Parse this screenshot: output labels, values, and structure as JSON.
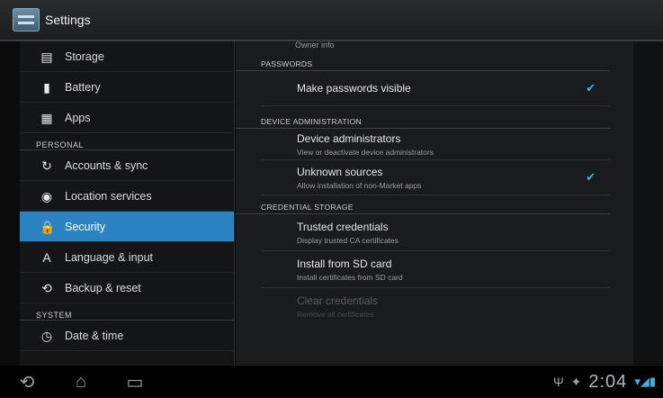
{
  "actionbar": {
    "title": "Settings"
  },
  "left": {
    "items": [
      {
        "type": "item",
        "label": "Storage",
        "icon": "storage-icon",
        "glyph": "▤"
      },
      {
        "type": "item",
        "label": "Battery",
        "icon": "battery-icon",
        "glyph": "▮"
      },
      {
        "type": "item",
        "label": "Apps",
        "icon": "apps-icon",
        "glyph": "▦"
      },
      {
        "type": "header",
        "label": "PERSONAL"
      },
      {
        "type": "item",
        "label": "Accounts & sync",
        "icon": "sync-icon",
        "glyph": "↻"
      },
      {
        "type": "item",
        "label": "Location services",
        "icon": "location-icon",
        "glyph": "◉"
      },
      {
        "type": "item",
        "label": "Security",
        "icon": "lock-icon",
        "glyph": "🔒",
        "active": true
      },
      {
        "type": "item",
        "label": "Language & input",
        "icon": "language-icon",
        "glyph": "A"
      },
      {
        "type": "item",
        "label": "Backup & reset",
        "icon": "backup-icon",
        "glyph": "⟲"
      },
      {
        "type": "header",
        "label": "SYSTEM"
      },
      {
        "type": "item",
        "label": "Date & time",
        "icon": "clock-icon",
        "glyph": "◷"
      }
    ]
  },
  "right": {
    "partial_top": "Owner info",
    "sections": {
      "passwords": "PASSWORDS",
      "device_admin": "DEVICE ADMINISTRATION",
      "credential_storage": "CREDENTIAL STORAGE"
    },
    "prefs": {
      "make_passwords_visible": {
        "title": "Make passwords visible",
        "checked": true
      },
      "device_administrators": {
        "title": "Device administrators",
        "summary": "View or deactivate device administrators"
      },
      "unknown_sources": {
        "title": "Unknown sources",
        "summary": "Allow installation of non-Market apps",
        "checked": true
      },
      "trusted_credentials": {
        "title": "Trusted credentials",
        "summary": "Display trusted CA certificates"
      },
      "install_from_sd": {
        "title": "Install from SD card",
        "summary": "Install certificates from SD card"
      },
      "clear_credentials": {
        "title": "Clear credentials",
        "summary": "Remove all certificates",
        "disabled": true
      }
    },
    "check_glyph": "✔"
  },
  "navbar": {
    "back_glyph": "⟲",
    "home_glyph": "⌂",
    "recent_glyph": "▭",
    "usb_glyph": "Ψ",
    "debug_glyph": "✦",
    "time": "2:04",
    "signal_glyph": "▾◢▮"
  },
  "colors": {
    "accent": "#33b5e5",
    "active_item": "#2b83c4"
  }
}
